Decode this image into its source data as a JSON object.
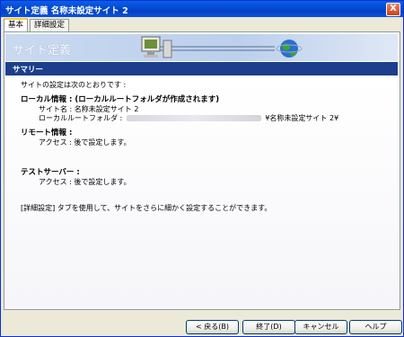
{
  "window": {
    "title": "サイト定義 名称未設定サイト 2",
    "close_symbol": "X"
  },
  "tabs": [
    {
      "label": "基本",
      "active": true
    },
    {
      "label": "詳細設定",
      "active": false
    }
  ],
  "banner": {
    "title": "サイト定義"
  },
  "summary": {
    "header": "サマリー",
    "intro": "サイトの設定は次のとおりです :",
    "local": {
      "heading": "ローカル情報 : (ローカルルートフォルダが作成されます)",
      "site_name": "サイト名 : 名称未設定サイト 2",
      "root_folder_label": "ローカルルートフォルダ :",
      "root_folder_suffix": "¥名称未設定サイト 2¥"
    },
    "remote": {
      "heading": "リモート情報 :",
      "access": "アクセス : 後で設定します。"
    },
    "testing": {
      "heading": "テストサーバー :",
      "access": "アクセス : 後で設定します。"
    },
    "note": "[詳細設定] タブを使用して、サイトをさらに細かく設定することができます。"
  },
  "buttons": {
    "back": "< 戻る(B)",
    "finish": "終了(D)",
    "cancel": "キャンセル",
    "help": "ヘルプ"
  },
  "colors": {
    "titlebar": "#0a52d8",
    "section_bar": "#1b3f8b",
    "banner": "#c9d9ef"
  },
  "icons": [
    "monitor-icon",
    "server-icon",
    "globe-icon",
    "close-icon"
  ]
}
